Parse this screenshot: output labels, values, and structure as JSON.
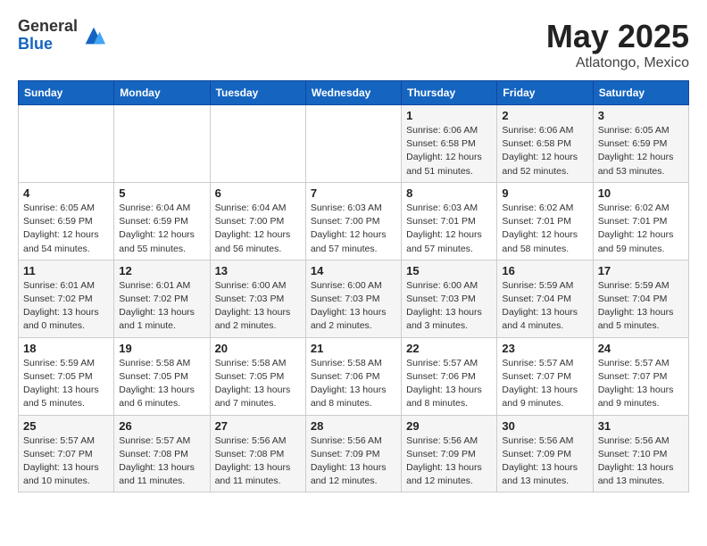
{
  "logo": {
    "general": "General",
    "blue": "Blue"
  },
  "title": {
    "month": "May 2025",
    "location": "Atlatongo, Mexico"
  },
  "days_of_week": [
    "Sunday",
    "Monday",
    "Tuesday",
    "Wednesday",
    "Thursday",
    "Friday",
    "Saturday"
  ],
  "weeks": [
    [
      {
        "day": "",
        "info": ""
      },
      {
        "day": "",
        "info": ""
      },
      {
        "day": "",
        "info": ""
      },
      {
        "day": "",
        "info": ""
      },
      {
        "day": "1",
        "info": "Sunrise: 6:06 AM\nSunset: 6:58 PM\nDaylight: 12 hours\nand 51 minutes."
      },
      {
        "day": "2",
        "info": "Sunrise: 6:06 AM\nSunset: 6:58 PM\nDaylight: 12 hours\nand 52 minutes."
      },
      {
        "day": "3",
        "info": "Sunrise: 6:05 AM\nSunset: 6:59 PM\nDaylight: 12 hours\nand 53 minutes."
      }
    ],
    [
      {
        "day": "4",
        "info": "Sunrise: 6:05 AM\nSunset: 6:59 PM\nDaylight: 12 hours\nand 54 minutes."
      },
      {
        "day": "5",
        "info": "Sunrise: 6:04 AM\nSunset: 6:59 PM\nDaylight: 12 hours\nand 55 minutes."
      },
      {
        "day": "6",
        "info": "Sunrise: 6:04 AM\nSunset: 7:00 PM\nDaylight: 12 hours\nand 56 minutes."
      },
      {
        "day": "7",
        "info": "Sunrise: 6:03 AM\nSunset: 7:00 PM\nDaylight: 12 hours\nand 57 minutes."
      },
      {
        "day": "8",
        "info": "Sunrise: 6:03 AM\nSunset: 7:01 PM\nDaylight: 12 hours\nand 57 minutes."
      },
      {
        "day": "9",
        "info": "Sunrise: 6:02 AM\nSunset: 7:01 PM\nDaylight: 12 hours\nand 58 minutes."
      },
      {
        "day": "10",
        "info": "Sunrise: 6:02 AM\nSunset: 7:01 PM\nDaylight: 12 hours\nand 59 minutes."
      }
    ],
    [
      {
        "day": "11",
        "info": "Sunrise: 6:01 AM\nSunset: 7:02 PM\nDaylight: 13 hours\nand 0 minutes."
      },
      {
        "day": "12",
        "info": "Sunrise: 6:01 AM\nSunset: 7:02 PM\nDaylight: 13 hours\nand 1 minute."
      },
      {
        "day": "13",
        "info": "Sunrise: 6:00 AM\nSunset: 7:03 PM\nDaylight: 13 hours\nand 2 minutes."
      },
      {
        "day": "14",
        "info": "Sunrise: 6:00 AM\nSunset: 7:03 PM\nDaylight: 13 hours\nand 2 minutes."
      },
      {
        "day": "15",
        "info": "Sunrise: 6:00 AM\nSunset: 7:03 PM\nDaylight: 13 hours\nand 3 minutes."
      },
      {
        "day": "16",
        "info": "Sunrise: 5:59 AM\nSunset: 7:04 PM\nDaylight: 13 hours\nand 4 minutes."
      },
      {
        "day": "17",
        "info": "Sunrise: 5:59 AM\nSunset: 7:04 PM\nDaylight: 13 hours\nand 5 minutes."
      }
    ],
    [
      {
        "day": "18",
        "info": "Sunrise: 5:59 AM\nSunset: 7:05 PM\nDaylight: 13 hours\nand 5 minutes."
      },
      {
        "day": "19",
        "info": "Sunrise: 5:58 AM\nSunset: 7:05 PM\nDaylight: 13 hours\nand 6 minutes."
      },
      {
        "day": "20",
        "info": "Sunrise: 5:58 AM\nSunset: 7:05 PM\nDaylight: 13 hours\nand 7 minutes."
      },
      {
        "day": "21",
        "info": "Sunrise: 5:58 AM\nSunset: 7:06 PM\nDaylight: 13 hours\nand 8 minutes."
      },
      {
        "day": "22",
        "info": "Sunrise: 5:57 AM\nSunset: 7:06 PM\nDaylight: 13 hours\nand 8 minutes."
      },
      {
        "day": "23",
        "info": "Sunrise: 5:57 AM\nSunset: 7:07 PM\nDaylight: 13 hours\nand 9 minutes."
      },
      {
        "day": "24",
        "info": "Sunrise: 5:57 AM\nSunset: 7:07 PM\nDaylight: 13 hours\nand 9 minutes."
      }
    ],
    [
      {
        "day": "25",
        "info": "Sunrise: 5:57 AM\nSunset: 7:07 PM\nDaylight: 13 hours\nand 10 minutes."
      },
      {
        "day": "26",
        "info": "Sunrise: 5:57 AM\nSunset: 7:08 PM\nDaylight: 13 hours\nand 11 minutes."
      },
      {
        "day": "27",
        "info": "Sunrise: 5:56 AM\nSunset: 7:08 PM\nDaylight: 13 hours\nand 11 minutes."
      },
      {
        "day": "28",
        "info": "Sunrise: 5:56 AM\nSunset: 7:09 PM\nDaylight: 13 hours\nand 12 minutes."
      },
      {
        "day": "29",
        "info": "Sunrise: 5:56 AM\nSunset: 7:09 PM\nDaylight: 13 hours\nand 12 minutes."
      },
      {
        "day": "30",
        "info": "Sunrise: 5:56 AM\nSunset: 7:09 PM\nDaylight: 13 hours\nand 13 minutes."
      },
      {
        "day": "31",
        "info": "Sunrise: 5:56 AM\nSunset: 7:10 PM\nDaylight: 13 hours\nand 13 minutes."
      }
    ]
  ]
}
